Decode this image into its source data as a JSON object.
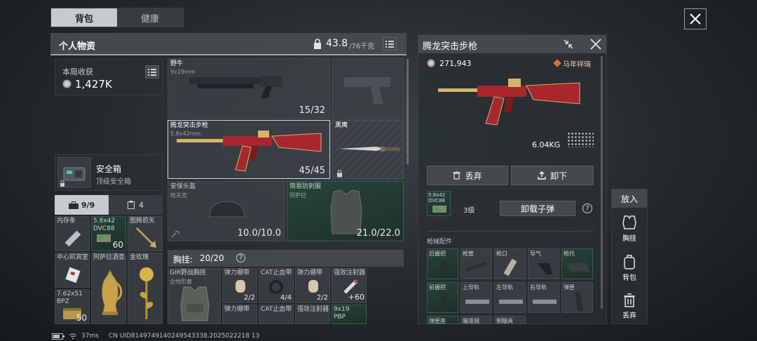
{
  "tabs": [
    {
      "label": "背包"
    },
    {
      "label": "健康"
    }
  ],
  "personal": {
    "title": "个人物资",
    "weight": "43.8",
    "weight_max": "/76千克",
    "earnings_label": "本局收获",
    "earnings_value": "1,427K",
    "safebox_name": "安全箱",
    "safebox_type": "顶级安全箱",
    "tab_case": "9/9",
    "tab_other": "4"
  },
  "stash": [
    {
      "name": "内存条",
      "count": ""
    },
    {
      "name": "5.8x42\nDVC88",
      "count": "60"
    },
    {
      "name": "图腾箭矢",
      "count": ""
    },
    {
      "name": "中心凯宾室",
      "count": ""
    },
    {
      "name": "阿萨拉酒壶",
      "count": ""
    },
    {
      "name": "金玫瑰",
      "count": ""
    },
    {
      "name": "7.62x51\nBPZ",
      "count": "50"
    }
  ],
  "weapons": {
    "primary_name": "野牛",
    "primary_ammo": "9x19mm",
    "primary_count": "15/32",
    "secondary_name": "腾龙突击步枪",
    "secondary_ammo": "5.8x42mm",
    "secondary_count": "45/45",
    "melee_name": "黑鹰",
    "helmet_name": "安保头盔",
    "helmet_brand": "哈夫克",
    "helmet_dur": "10.0/10.0",
    "armor_name": "简易防刺服",
    "armor_brand": "阿萨拉",
    "armor_dur": "21.0/22.0"
  },
  "chest": {
    "label": "胸挂:",
    "value": "20/20",
    "help": "?",
    "rig_name": "GIR野战胸挂",
    "rig_sub": "全地形套",
    "items": [
      {
        "name": "弹力绷带",
        "count": ""
      },
      {
        "name": "CAT止血带",
        "count": ""
      },
      {
        "name": "弹力绷带",
        "count": ""
      },
      {
        "name": "强效注射器",
        "count": ""
      },
      {
        "name": "",
        "count": "2/2"
      },
      {
        "name": "",
        "count": "4/4"
      },
      {
        "name": "",
        "count": "2/2"
      },
      {
        "name": "",
        "count": "+60"
      },
      {
        "name": "弹力绷带",
        "count": ""
      },
      {
        "name": "CAT止血带",
        "count": ""
      },
      {
        "name": "强效注射器",
        "count": ""
      },
      {
        "name": "9x19\nPBP",
        "count": ""
      }
    ]
  },
  "detail": {
    "title": "腾龙突击步枪",
    "price": "271,943",
    "skin": "马年祥瑞",
    "weight": "6.04KG",
    "discard": "丢弃",
    "unload": "卸下",
    "ammo_name": "5.8x42\nDVC88",
    "ammo_level": "3级",
    "unload_ammo": "卸载子弹",
    "help": "?",
    "parts_title": "枪械配件",
    "parts": [
      {
        "label": "后握把"
      },
      {
        "label": "枪管"
      },
      {
        "label": "枪口"
      },
      {
        "label": "导气"
      },
      {
        "label": "枪托"
      },
      {
        "label": "前握把"
      },
      {
        "label": "上导轨"
      },
      {
        "label": "左导轨"
      },
      {
        "label": "右导轨"
      },
      {
        "label": "弹匣"
      },
      {
        "label": "弹匣座"
      },
      {
        "label": "瞄准镜"
      },
      {
        "label": "侧瞄具"
      }
    ]
  },
  "quick": {
    "title": "放入",
    "items": [
      {
        "label": "胸挂"
      },
      {
        "label": "背包"
      },
      {
        "label": "丢弃"
      }
    ]
  },
  "status": {
    "ping": "37ms",
    "uid": "CN UID8149749140249543338,2025022218 13"
  }
}
